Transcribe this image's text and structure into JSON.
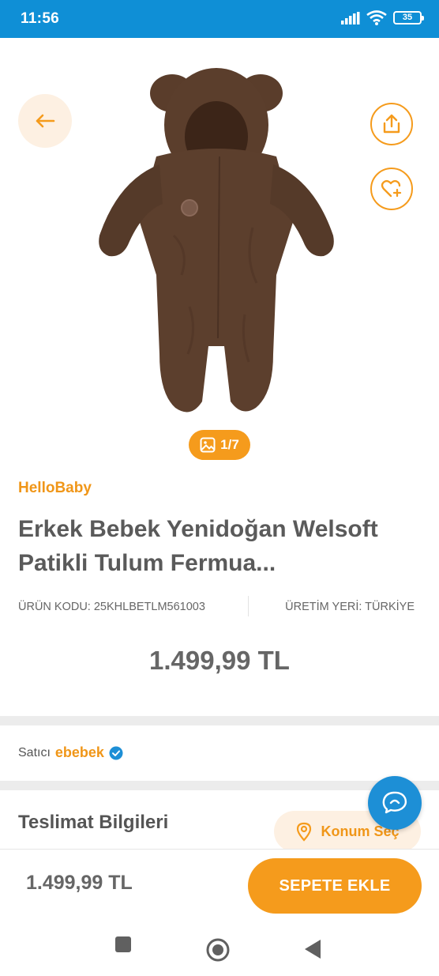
{
  "status_bar": {
    "time": "11:56",
    "battery": "35"
  },
  "gallery": {
    "counter": "1/7"
  },
  "product": {
    "brand": "HelloBaby",
    "title": "Erkek Bebek Yenidoğan Welsoft Patikli Tulum Fermua...",
    "code_label": "ÜRÜN KODU: 25KHLBETLM561003",
    "origin_label": "ÜRETİM YERİ: TÜRKİYE",
    "price": "1.499,99 TL"
  },
  "seller": {
    "label": "Satıcı",
    "name": "ebebek"
  },
  "delivery": {
    "title": "Teslimat Bilgileri",
    "location_button": "Konum Seç"
  },
  "bottom_bar": {
    "price": "1.499,99 TL",
    "add_to_cart": "SEPETE EKLE"
  },
  "colors": {
    "accent": "#f59b1c",
    "brand_text": "#f09618",
    "status_bar": "#0f8fd6",
    "chat": "#1d8fd6",
    "product": "#5a3d2b"
  }
}
